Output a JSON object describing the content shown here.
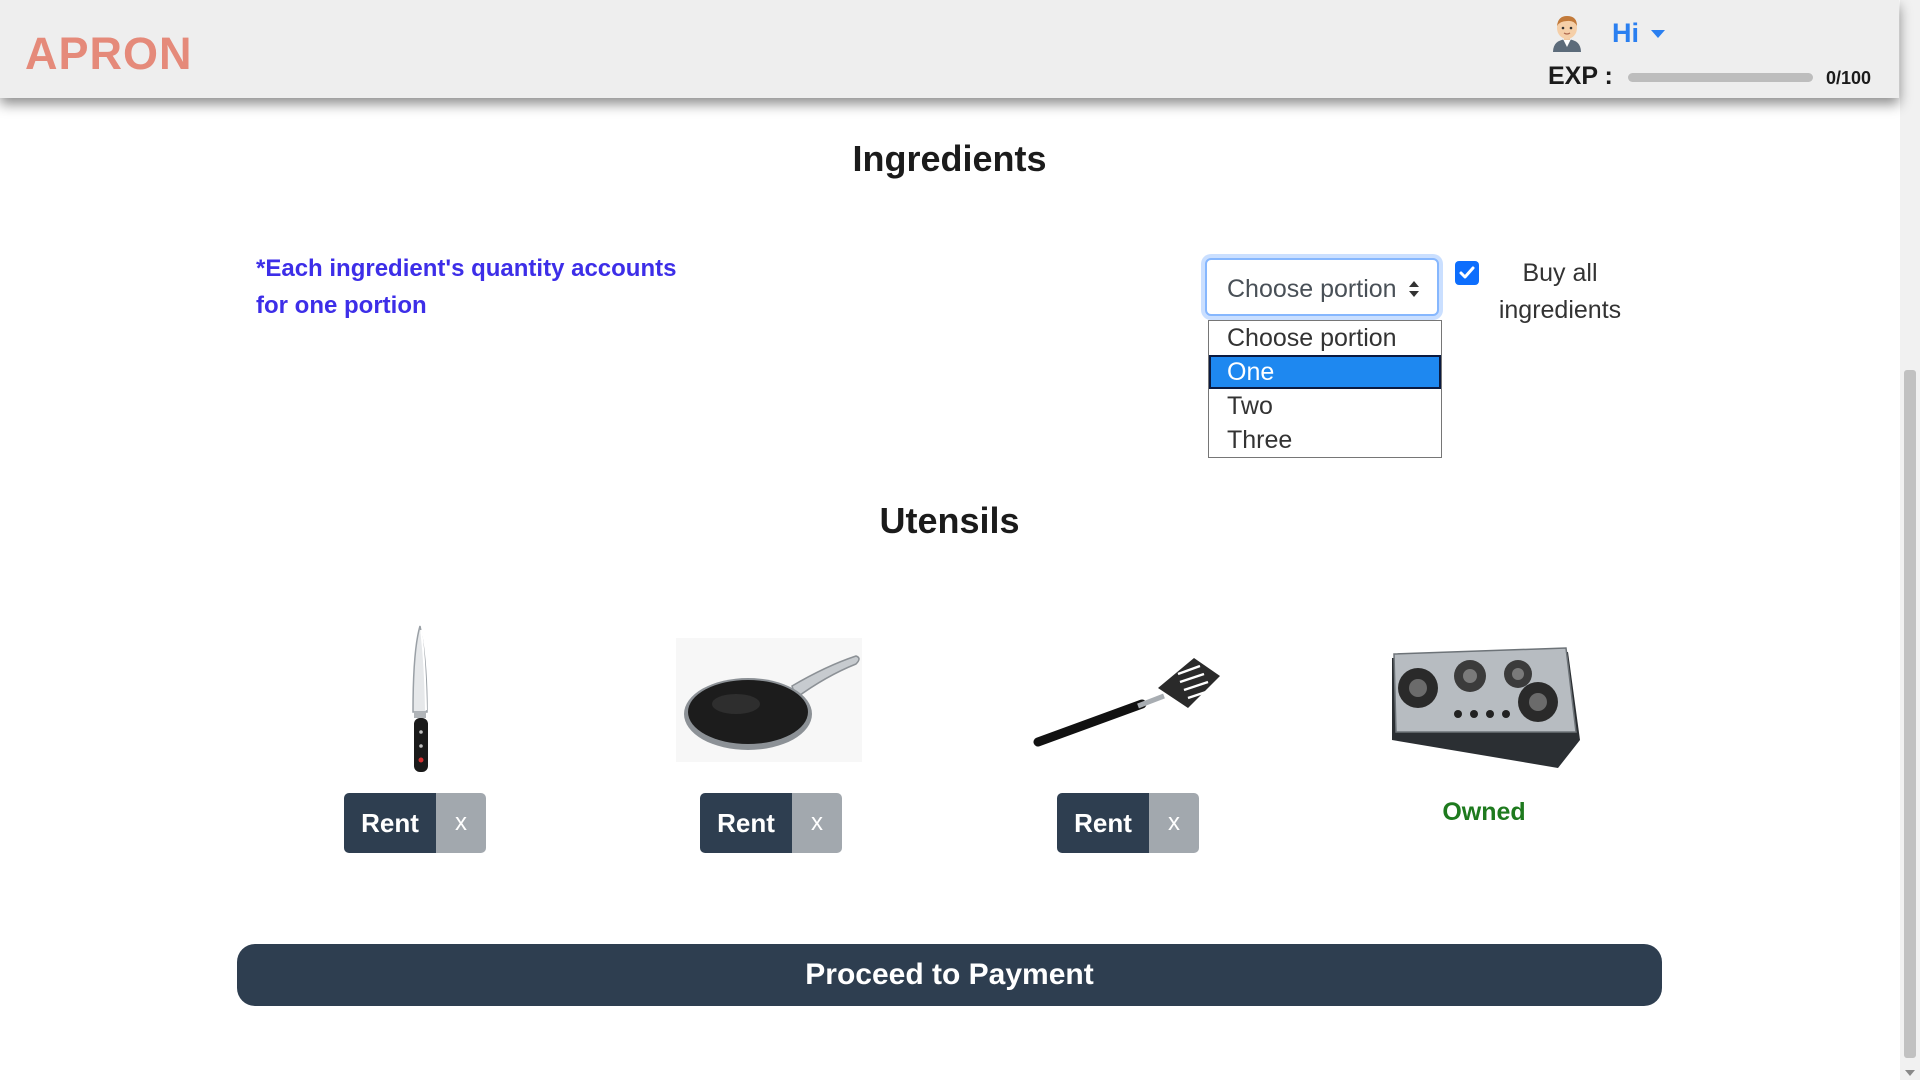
{
  "header": {
    "logo": "APRON",
    "user_menu_label": "Hi",
    "exp_label": "EXP :",
    "exp_value": "0/100",
    "exp_progress": 0.0
  },
  "ingredients": {
    "title": "Ingredients",
    "note": "*Each ingredient's quantity accounts for one portion",
    "portion_select": {
      "selected": "Choose portion",
      "options": [
        "Choose portion",
        "One",
        "Two",
        "Three"
      ],
      "highlighted_option": "One"
    },
    "buy_all_checked": true,
    "buy_all_label": "Buy all ingredients"
  },
  "utensils": {
    "title": "Utensils",
    "items": [
      {
        "icon": "knife-icon",
        "rent_label": "Rent",
        "remove_label": "x"
      },
      {
        "icon": "frying-pan-icon",
        "rent_label": "Rent",
        "remove_label": "x"
      },
      {
        "icon": "spatula-icon",
        "rent_label": "Rent",
        "remove_label": "x"
      },
      {
        "icon": "gas-stove-icon",
        "status": "Owned"
      }
    ]
  },
  "proceed_label": "Proceed to Payment",
  "colors": {
    "logo": "#e58a7a",
    "accent_blue": "#2a7ff0",
    "note_text": "#3d2ee8",
    "dark_button": "#2e3e50",
    "owned_green": "#1e7a1e"
  }
}
